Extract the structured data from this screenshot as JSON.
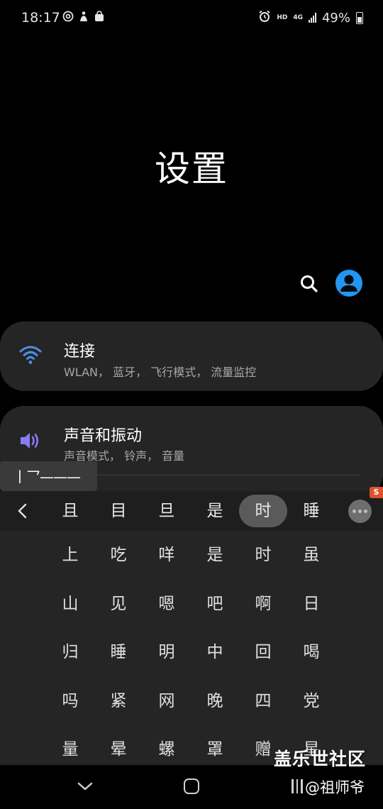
{
  "status_bar": {
    "time": "18:17",
    "left_icons": [
      "target-icon",
      "figure-icon",
      "shopping-bag-icon"
    ],
    "hd_label": "HD",
    "network_label": "4G",
    "battery": "49%",
    "battery_level": 0.49
  },
  "page": {
    "title": "设置"
  },
  "header_actions": {
    "search_icon": "search-icon",
    "account_icon": "account-icon",
    "accent_color": "#2196f3"
  },
  "settings": [
    {
      "title": "连接",
      "subtitle": "WLAN， 蓝牙， 飞行模式， 流量监控",
      "icon": "wifi-icon",
      "icon_color": "#4a8fe7"
    },
    {
      "title": "声音和振动",
      "subtitle": "声音模式， 铃声， 音量",
      "icon": "speaker-icon",
      "icon_color": "#8a7cf0"
    }
  ],
  "keyboard": {
    "handwriting_preview": "丨乛———",
    "candidates": [
      "且",
      "目",
      "旦",
      "是",
      "时",
      "睡"
    ],
    "selected_index": 4,
    "brand_badge": "S",
    "grid": [
      [
        "上",
        "吃",
        "咩",
        "是",
        "时",
        "虽"
      ],
      [
        "山",
        "见",
        "嗯",
        "吧",
        "啊",
        "日"
      ],
      [
        "归",
        "睡",
        "明",
        "中",
        "回",
        "喝"
      ],
      [
        "吗",
        "紧",
        "网",
        "晚",
        "四",
        "党"
      ],
      [
        "量",
        "晕",
        "螺",
        "罩",
        "赠",
        "星"
      ]
    ]
  },
  "watermark": {
    "line1": "盖乐世社区",
    "line2": "@祖师爷"
  }
}
